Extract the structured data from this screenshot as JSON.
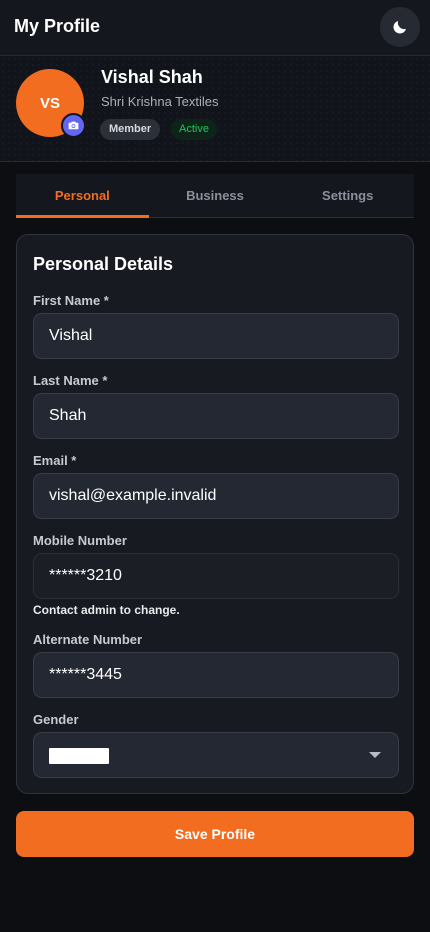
{
  "header": {
    "title": "My Profile",
    "theme_icon": "moon-icon"
  },
  "profile": {
    "initials": "VS",
    "name": "Vishal Shah",
    "company": "Shri Krishna Textiles",
    "role_badge": "Member",
    "status_badge": "Active",
    "camera_icon": "camera-icon"
  },
  "tabs": [
    {
      "label": "Personal",
      "active": true
    },
    {
      "label": "Business",
      "active": false
    },
    {
      "label": "Settings",
      "active": false
    }
  ],
  "form": {
    "title": "Personal Details",
    "first_name": {
      "label": "First Name *",
      "value": "Vishal"
    },
    "last_name": {
      "label": "Last Name *",
      "value": "Shah"
    },
    "email": {
      "label": "Email *",
      "value": "vishal@example.invalid"
    },
    "mobile": {
      "label": "Mobile Number",
      "value": "******3210",
      "hint": "Contact admin to change."
    },
    "alternate": {
      "label": "Alternate Number",
      "value": "******3445"
    },
    "gender": {
      "label": "Gender"
    }
  },
  "actions": {
    "save_label": "Save Profile"
  },
  "colors": {
    "accent": "#f26d1f",
    "camera_badge": "#6366f1",
    "active_status": "#22c55e"
  }
}
